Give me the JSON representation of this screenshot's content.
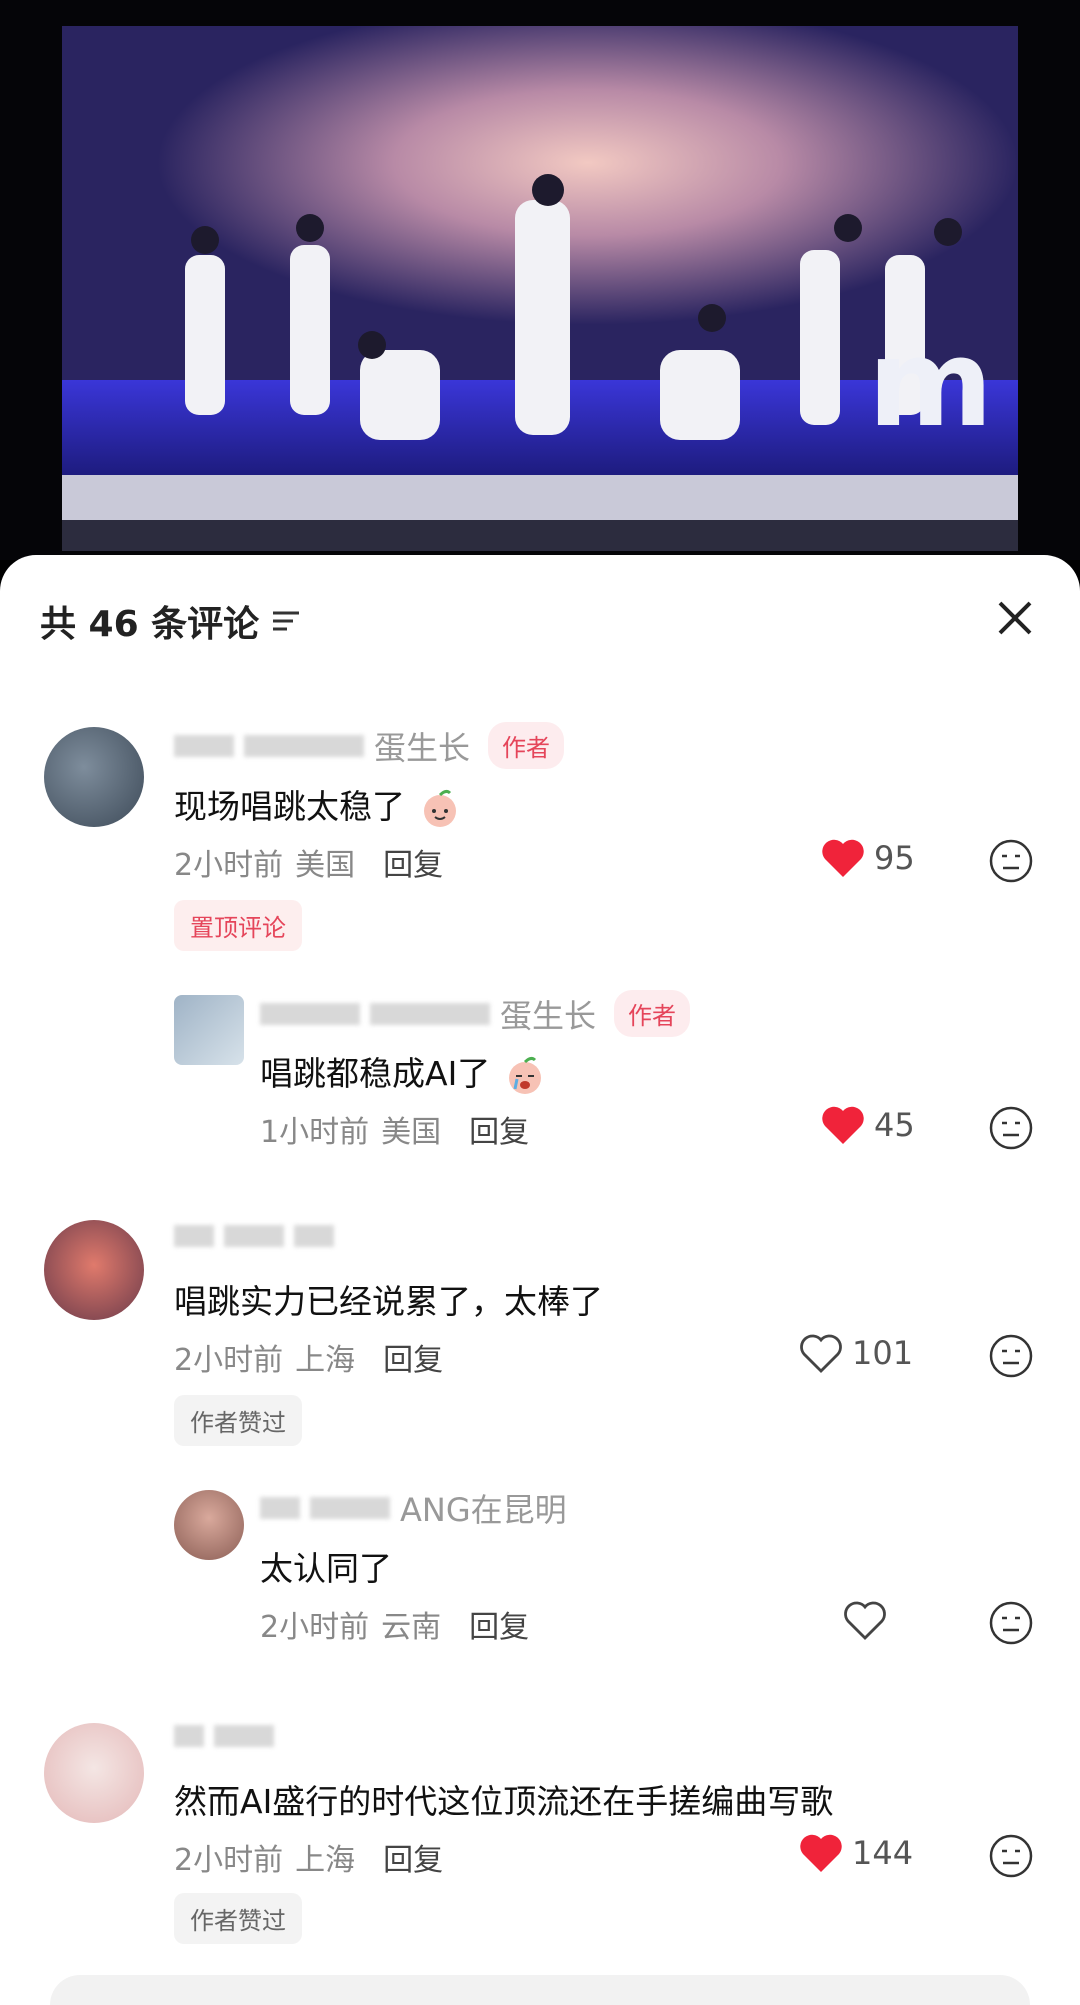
{
  "video": {
    "logo_text": "m"
  },
  "header": {
    "title": "共 46 条评论",
    "sort_icon": "sort-lines-icon",
    "close_icon": "close-icon"
  },
  "comments": [
    {
      "username": "蛋生长",
      "author_tag": "作者",
      "text": "现场唱跳太稳了",
      "emoji": "peach-smile-emoji",
      "time": "2小时前",
      "location": "美国",
      "reply": "回复",
      "likes": "95",
      "liked": true,
      "pill": "置顶评论"
    },
    {
      "username": "蛋生长",
      "author_tag": "作者",
      "text": "唱跳都稳成AI了",
      "emoji": "peach-cry-emoji",
      "time": "1小时前",
      "location": "美国",
      "reply": "回复",
      "likes": "45",
      "liked": true
    },
    {
      "username": "",
      "text": "唱跳实力已经说累了，太棒了",
      "time": "2小时前",
      "location": "上海",
      "reply": "回复",
      "likes": "101",
      "liked": false,
      "pill": "作者赞过"
    },
    {
      "username": "ANG在昆明",
      "text": "太认同了",
      "time": "2小时前",
      "location": "云南",
      "reply": "回复",
      "likes": "",
      "liked": false
    },
    {
      "username": "",
      "text": "然而AI盛行的时代这位顶流还在手搓编曲写歌",
      "time": "2小时前",
      "location": "上海",
      "reply": "回复",
      "likes": "144",
      "liked": true,
      "pill": "作者赞过"
    }
  ],
  "colors": {
    "like_red": "#f0233a",
    "author_tag_bg": "#fdecee",
    "author_tag_text": "#e5455a"
  }
}
